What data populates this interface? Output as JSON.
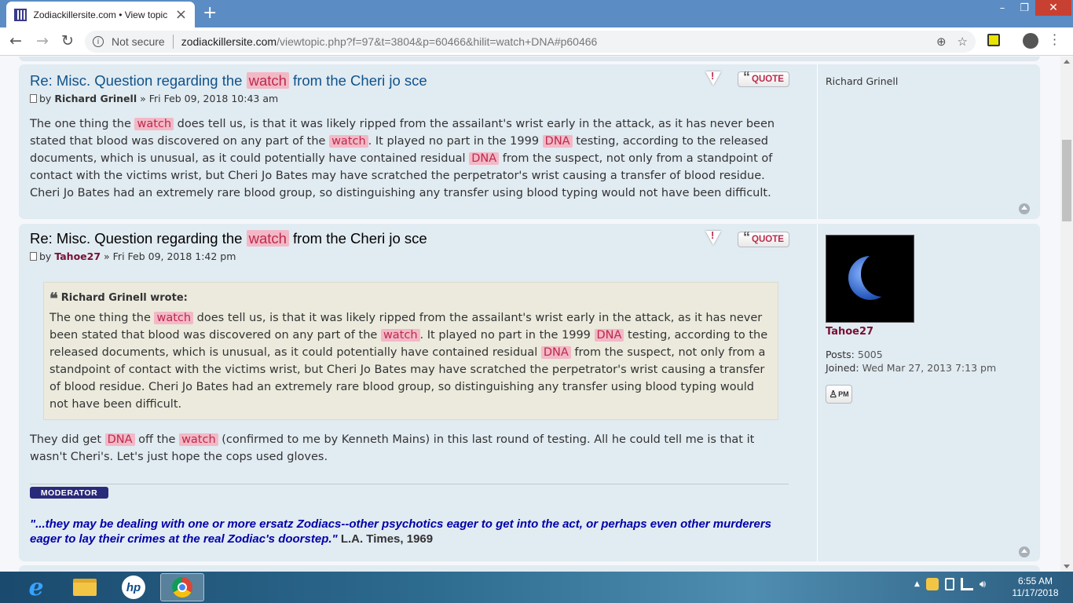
{
  "browser": {
    "tab_title": "Zodiackillersite.com • View topic",
    "tab_close": "×",
    "new_tab": "+",
    "minimize": "–",
    "maximize": "❐",
    "close": "✕",
    "back": "←",
    "forward": "→",
    "reload": "↻",
    "security_label": "Not secure",
    "url_host": "zodiackillersite.com",
    "url_path": "/viewtopic.php?f=97&t=3804&p=60466&hilit=watch+DNA#p60466",
    "zoom_icon": "⊕",
    "star_icon": "☆"
  },
  "posts": [
    {
      "title_prefix": "Re: Misc. Question regarding the",
      "title_hl": "watch",
      "title_suffix": "from the Cheri jo sce",
      "meta_by": "by",
      "author": "Richard Grinell",
      "date": "» Fri Feb 09, 2018 10:43 am",
      "quote_label": "QUOTE",
      "profile_name": "Richard Grinell",
      "content": [
        {
          "t": "The one thing the "
        },
        {
          "h": "watch"
        },
        {
          "t": " does tell us, is that it was likely ripped from the assailant's wrist early in the attack, as it has never been stated that blood was discovered on any part of the "
        },
        {
          "h": "watch"
        },
        {
          "t": ". It played no part in the 1999 "
        },
        {
          "h": "DNA"
        },
        {
          "t": " testing, according to the released documents, which is unusual, as it could potentially have contained residual "
        },
        {
          "h": "DNA"
        },
        {
          "t": " from the suspect, not only from a standpoint of contact with the victims wrist, but Cheri Jo Bates may have scratched the perpetrator's wrist causing a transfer of blood residue. Cheri Jo Bates had an extremely rare blood group, so distinguishing any transfer using blood typing would not have been difficult."
        }
      ]
    },
    {
      "title_prefix": "Re: Misc. Question regarding the",
      "title_hl": "watch",
      "title_suffix": "from the Cheri jo sce",
      "meta_by": "by",
      "author": "Tahoe27",
      "date": "» Fri Feb 09, 2018 1:42 pm",
      "quote_label": "QUOTE",
      "quote_cite": "Richard Grinell wrote:",
      "quote_content": [
        {
          "t": "The one thing the "
        },
        {
          "h": "watch"
        },
        {
          "t": " does tell us, is that it was likely ripped from the assailant's wrist early in the attack, as it has never been stated that blood was discovered on any part of the "
        },
        {
          "h": "watch"
        },
        {
          "t": ". It played no part in the 1999 "
        },
        {
          "h": "DNA"
        },
        {
          "t": " testing, according to the released documents, which is unusual, as it could potentially have contained residual "
        },
        {
          "h": "DNA"
        },
        {
          "t": " from the suspect, not only from a standpoint of contact with the victims wrist, but Cheri Jo Bates may have scratched the perpetrator's wrist causing a transfer of blood residue. Cheri Jo Bates had an extremely rare blood group, so distinguishing any transfer using blood typing would not have been difficult."
        }
      ],
      "content": [
        {
          "t": "They did get "
        },
        {
          "h": "DNA"
        },
        {
          "t": " off the "
        },
        {
          "h": "watch"
        },
        {
          "t": " (confirmed to me by Kenneth Mains) in this last round of testing. All he could tell me is that it wasn't Cheri's. Let's just hope the cops used gloves."
        }
      ],
      "moderator_badge": "MODERATOR",
      "signature_quote": "\"...they may be dealing with one or more ersatz Zodiacs--other psychotics eager to get into the act, or perhaps even other murderers eager to lay their crimes at the real Zodiac's doorstep.\"",
      "signature_source": "L.A. Times, 1969",
      "profile_user": "Tahoe27",
      "posts_label": "Posts:",
      "posts_value": "5005",
      "joined_label": "Joined:",
      "joined_value": "Wed Mar 27, 2013 7:13 pm",
      "pm_label": "PM"
    }
  ],
  "taskbar": {
    "time": "6:55 AM",
    "date": "11/17/2018",
    "hp_label": "hp",
    "ie_label": "e"
  },
  "colors": {
    "highlight_bg": "#f3b8c6",
    "highlight_fg": "#bc2a4d",
    "post_bg": "#e1ebf2",
    "title_link": "#105289",
    "author_red": "#771135",
    "signature_blue": "#0000a8"
  }
}
